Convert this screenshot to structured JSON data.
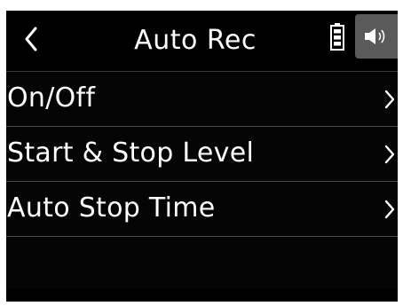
{
  "header": {
    "title": "Auto Rec",
    "back_icon": "chevron-left-icon",
    "battery_icon": "battery-icon",
    "speaker_icon": "speaker-icon"
  },
  "menu": {
    "items": [
      {
        "label": "On/Off"
      },
      {
        "label": "Start & Stop Level"
      },
      {
        "label": "Auto Stop Time"
      }
    ]
  },
  "colors": {
    "background": "#050505",
    "text": "#ffffff",
    "divider": "#4a4a4a",
    "speaker_box": "#5a5a5a"
  }
}
